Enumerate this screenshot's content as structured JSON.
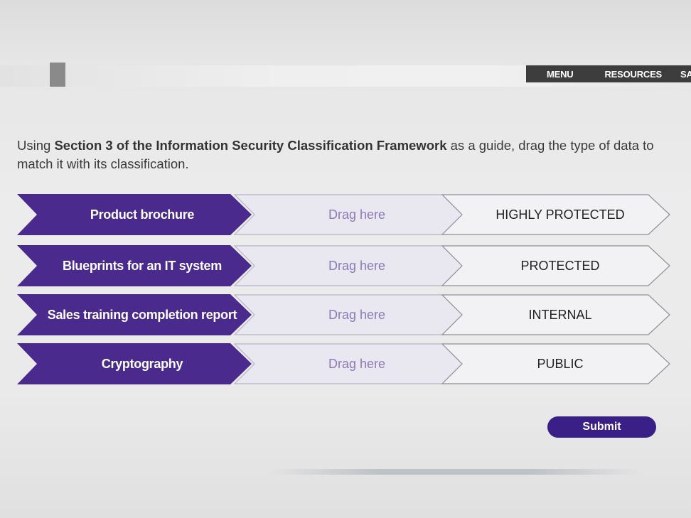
{
  "nav": {
    "menu": "MENU",
    "resources": "RESOURCES",
    "save": "SAVE"
  },
  "prompt": {
    "before": "Using ",
    "bold": "Section 3 of the Information Security Classification Framework",
    "after": " as a guide, drag the type of data to match it with its classification."
  },
  "rows": [
    {
      "item": "Product brochure",
      "drop": "Drag here",
      "classification": "HIGHLY PROTECTED"
    },
    {
      "item": "Blueprints for an IT system",
      "drop": "Drag here",
      "classification": "PROTECTED"
    },
    {
      "item": "Sales training completion report",
      "drop": "Drag here",
      "classification": "INTERNAL"
    },
    {
      "item": "Cryptography",
      "drop": "Drag here",
      "classification": "PUBLIC"
    }
  ],
  "submit": "Submit",
  "colors": {
    "accent": "#4a2a8c",
    "submit": "#3a1f86",
    "drop_text": "#8d7bb6",
    "nav_bg": "#3d3d3d"
  }
}
